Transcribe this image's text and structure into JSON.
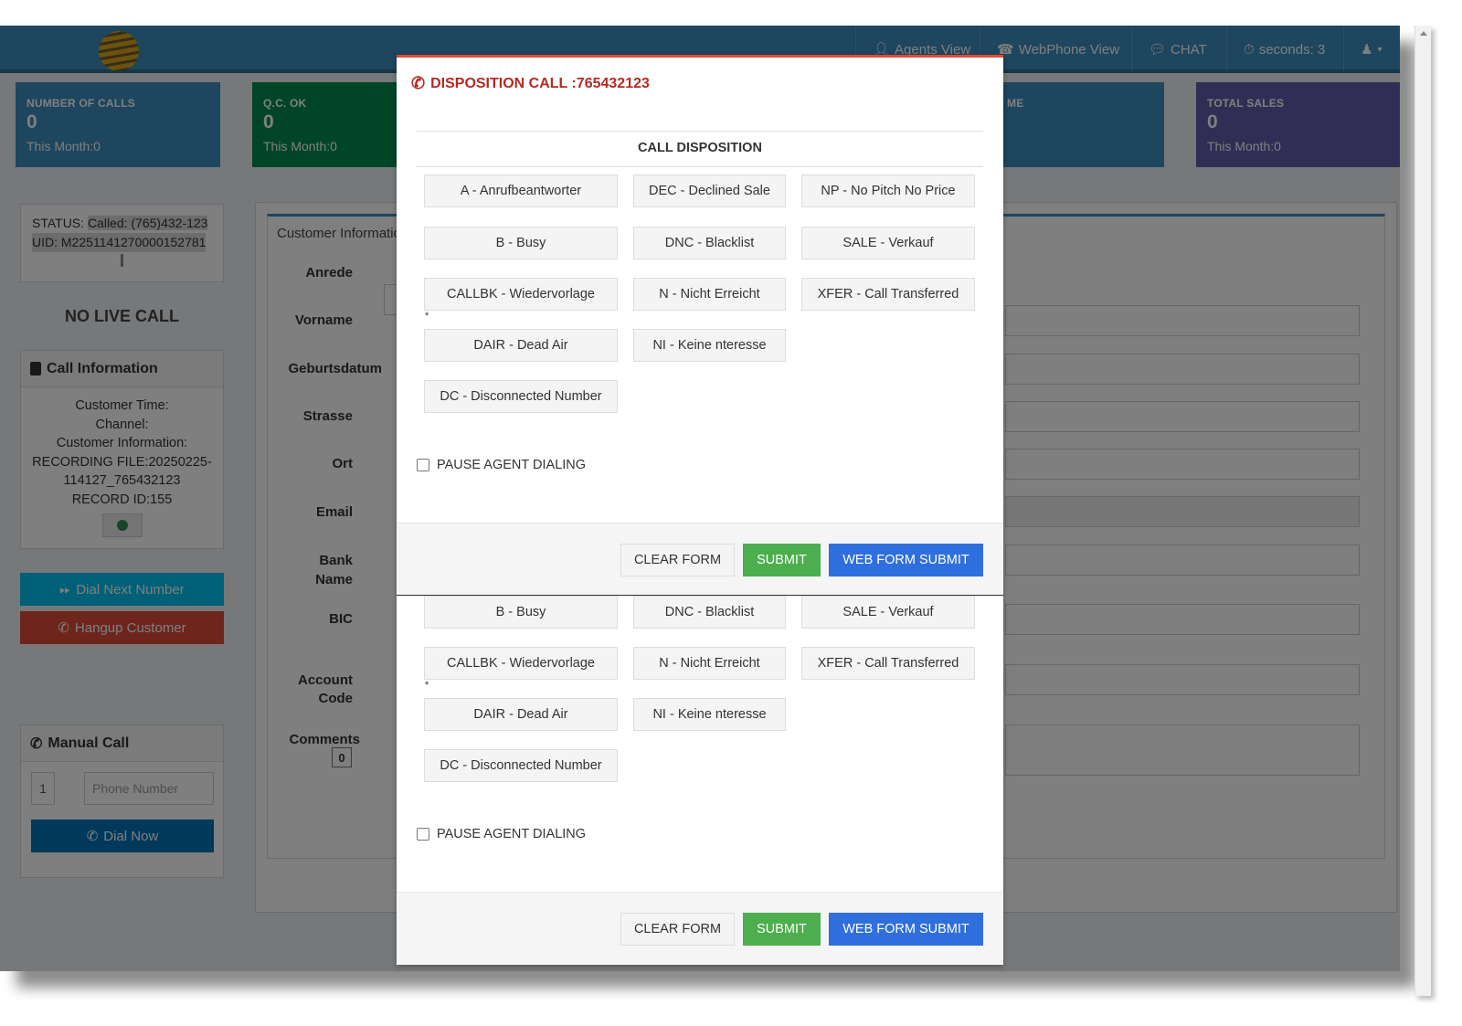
{
  "header": {
    "nav": [
      {
        "icon": "user-icon",
        "label": "Agents View"
      },
      {
        "icon": "headset-icon",
        "label": "WebPhone View"
      },
      {
        "icon": "chat-icon",
        "label": "CHAT"
      },
      {
        "icon": "stopwatch-icon",
        "label": "seconds: 3"
      }
    ]
  },
  "cards": [
    {
      "label": "NUMBER OF CALLS",
      "value": "0",
      "sub": "This Month:0",
      "color": "#3c8dbc"
    },
    {
      "label": "Q.C. OK",
      "value": "0",
      "sub": "This Month:0",
      "color": "#008d4c"
    },
    {
      "label": "ME",
      "value": "",
      "sub": "",
      "color": "#3c8dbc"
    },
    {
      "label": "TOTAL SALES",
      "value": "0",
      "sub": "This Month:0",
      "color": "#605ca8"
    }
  ],
  "status": {
    "line1_prefix": "STATUS:",
    "line1_value": "Called: (765)432-123",
    "line2": "UID: M2251141270000152781",
    "no_live_call": "NO LIVE CALL"
  },
  "call_info": {
    "title": "Call Information",
    "lines": [
      "Customer Time:",
      "Channel:",
      "Customer Information:",
      "RECORDING FILE:20250225-",
      "114127_765432123",
      "RECORD ID:155"
    ]
  },
  "actions": {
    "dial_next": "Dial Next Number",
    "hangup": "Hangup Customer"
  },
  "manual_call": {
    "title": "Manual Call",
    "code_value": "1",
    "phone_placeholder": "Phone Number",
    "dial_now": "Dial Now"
  },
  "customer_form": {
    "tab": "Customer Informatio",
    "labels": [
      "Anrede",
      "Vorname",
      "Geburtsdatum",
      "Strasse",
      "Ort",
      "Email",
      "Bank Name",
      "BIC",
      "Account Code",
      "Comments"
    ],
    "comments_count": "0"
  },
  "modal": {
    "title": "DISPOSITION CALL :765432123",
    "section_title": "CALL DISPOSITION",
    "dispositions": [
      "A - Anrufbeantworter",
      "DEC - Declined Sale",
      "NP - No Pitch No Price",
      "B - Busy",
      "DNC - Blacklist",
      "SALE - Verkauf",
      "CALLBK - Wiedervorlage",
      "N - Nicht Erreicht",
      "XFER - Call Transferred",
      "DAIR - Dead Air",
      "NI - Keine nteresse",
      "DC - Disconnected Number"
    ],
    "asterisk": "*",
    "pause_label": "PAUSE AGENT DIALING",
    "clear_form": "CLEAR FORM",
    "submit": "SUBMIT",
    "web_form_submit": "WEB FORM SUBMIT"
  },
  "colors": {
    "header": "#3c8dbc",
    "dial_next": "#00c0ef",
    "hangup": "#dd4b39",
    "dial_now": "#0073b7",
    "submit": "#4cae4c",
    "web_form_submit": "#2f6fdd",
    "modal_title": "#b52a22"
  }
}
